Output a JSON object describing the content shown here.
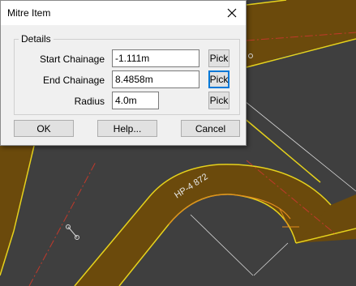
{
  "dialog": {
    "title": "Mitre Item",
    "close_icon": "close-icon",
    "group_label": "Details",
    "fields": [
      {
        "label": "Start Chainage",
        "value": "-1.111m",
        "pick_label": "Pick"
      },
      {
        "label": "End Chainage",
        "value": "8.4858m",
        "pick_label": "Pick"
      },
      {
        "label": "Radius",
        "value": "4.0m",
        "pick_label": "Pick"
      }
    ],
    "buttons": {
      "ok": "OK",
      "help": "Help...",
      "cancel": "Cancel"
    }
  },
  "drawing": {
    "road_label": "HP-4 872",
    "colors": {
      "background": "#3f3f3f",
      "road_fill": "#6b4a0c",
      "road_edge": "#e6d21c",
      "kerb_orange": "#e08a1e",
      "centerline_red": "#c0392b",
      "line_white": "#d9d9d9"
    }
  }
}
